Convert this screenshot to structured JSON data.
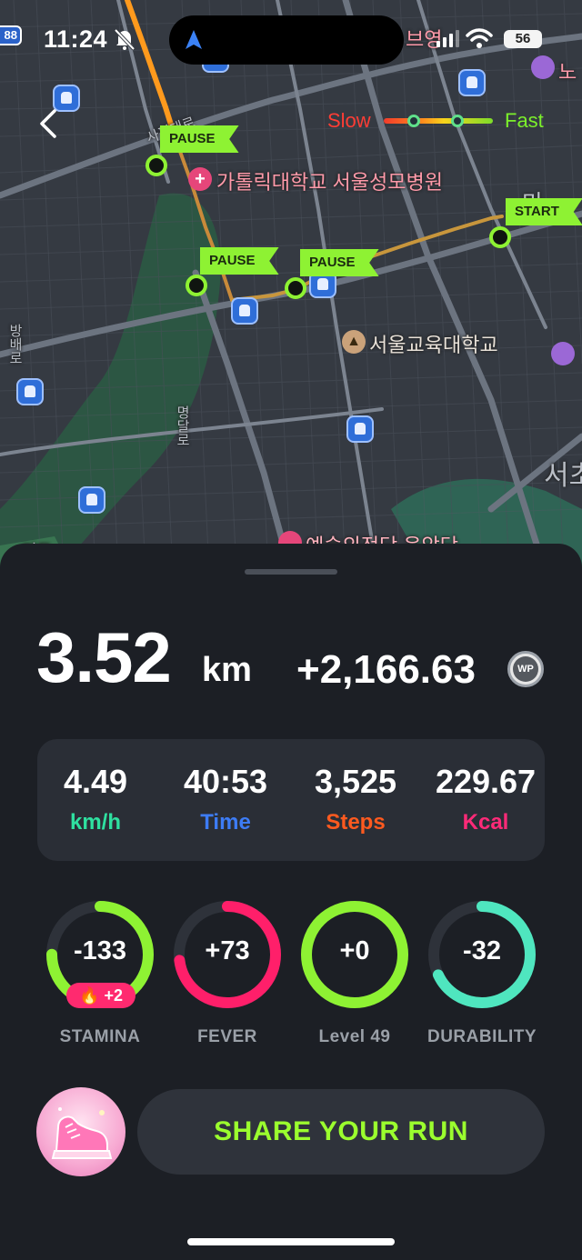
{
  "status_bar": {
    "time": "11:24",
    "battery": "56",
    "route_badge": "88"
  },
  "map": {
    "legend": {
      "slow_label": "Slow",
      "fast_label": "Fast"
    },
    "flags": {
      "start": "START",
      "pause_1": "PAUSE",
      "pause_2": "PAUSE",
      "pause_3": "PAUSE"
    },
    "labels": {
      "hospital": "가톨릭대학교 서울성모병원",
      "university": "서울교육대학교",
      "top_right": "브영",
      "top_right_2": "노",
      "far_right": "서초",
      "bottom": "예술의전당 음악당",
      "road_1": "사평대로",
      "road_2": "방배로",
      "road_3": "명달로",
      "partial_right": "마",
      "bottom_left": "지도"
    },
    "colors": {
      "route_slow": "#f23b2b",
      "route_mid": "#ff9a1d",
      "route_fast": "#7ddc2a",
      "flag": "#8ef233"
    }
  },
  "summary": {
    "distance": "3.52",
    "distance_unit": "km",
    "earned": "+2,166.63",
    "currency_icon": "WP"
  },
  "stats": [
    {
      "value": "4.49",
      "label": "km/h",
      "color": "#2fe0a0"
    },
    {
      "value": "40:53",
      "label": "Time",
      "color": "#3d7cf5"
    },
    {
      "value": "3,525",
      "label": "Steps",
      "color": "#ff5a1f"
    },
    {
      "value": "229.67",
      "label": "Kcal",
      "color": "#ff2a78"
    }
  ],
  "gauges": [
    {
      "value": "-133",
      "label": "STAMINA",
      "fill": 0.75,
      "color": "#8ef233",
      "badge": "+2"
    },
    {
      "value": "+73",
      "label": "FEVER",
      "fill": 0.73,
      "color": "#ff1f6a"
    },
    {
      "value": "+0",
      "label": "Level 49",
      "fill": 1.0,
      "color": "#8ef233"
    },
    {
      "value": "-32",
      "label": "DURABILITY",
      "fill": 0.68,
      "color": "#4fe6bf"
    }
  ],
  "share": {
    "label": "SHARE YOUR RUN"
  }
}
